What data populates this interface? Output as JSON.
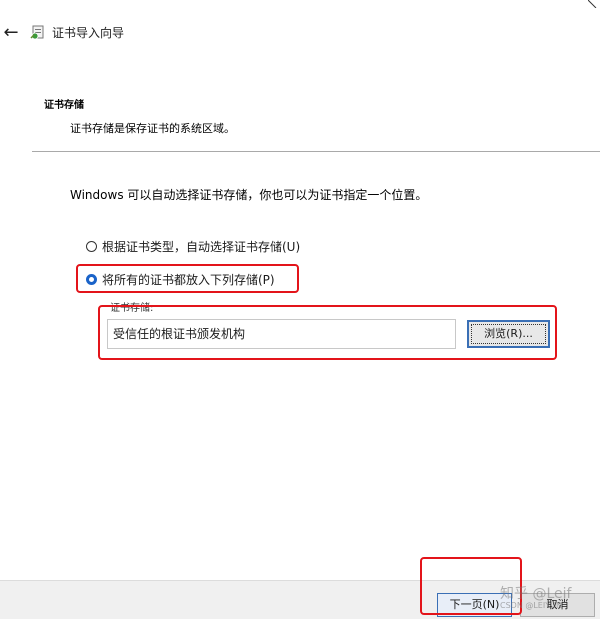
{
  "window": {
    "title": "证书导入向导",
    "back_glyph": "←"
  },
  "header": {
    "title": "证书存储",
    "subtitle": "证书存储是保存证书的系统区域。"
  },
  "body": {
    "intro": "Windows 可以自动选择证书存储，你也可以为证书指定一个位置。",
    "radio_auto_label": "根据证书类型，自动选择证书存储(U)",
    "radio_manual_label": "将所有的证书都放入下列存储(P)",
    "selected_option": "manual",
    "store_group_label": "证书存储:",
    "store_value": "受信任的根证书颁发机构",
    "browse_label": "浏览(R)..."
  },
  "footer": {
    "next_label": "下一页(N)",
    "cancel_label": "取消"
  },
  "watermarks": {
    "zhihu": "知乎 @Leif",
    "csdn": "CSDN @LEIYUN"
  },
  "colors": {
    "highlight": "#e3141a",
    "accent": "#1a63c9"
  }
}
